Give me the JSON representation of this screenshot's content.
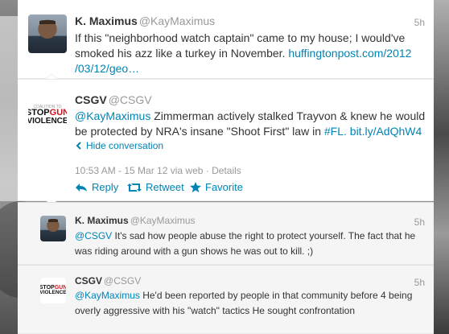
{
  "tweet1": {
    "name": "K. Maximus",
    "handle": "@KayMaximus",
    "time": "5h",
    "text_prefix": "If this \"neighborhood watch captain\" came to my house; I would've smoked his azz like a turkey in November.",
    "link_line1": "huffingtonpost.com/2012",
    "link_line2": "/03/12/geo…"
  },
  "tweet2": {
    "name": "CSGV",
    "handle": "@CSGV",
    "mention": "@KayMaximus",
    "text_mid": "Zimmerman actively stalked Trayvon & knew he would be protected by NRA's insane \"Shoot First\" law in",
    "hashtag": "#FL.",
    "link": "bit.ly/AdQhW4",
    "hide_label": "Hide conversation",
    "timestamp": "10:53 AM - 15 Mar 12",
    "via": "via web",
    "details": "Details",
    "actions": {
      "reply": "Reply",
      "retweet": "Retweet",
      "favorite": "Favorite"
    }
  },
  "reply1": {
    "name": "K. Maximus",
    "handle": "@KayMaximus",
    "time": "5h",
    "mention": "@CSGV",
    "text": "It's sad how people abuse the right to protect yourself. The fact that he was riding around with a gun shows he was out to kill. ;)"
  },
  "reply2": {
    "name": "CSGV",
    "handle": "@CSGV",
    "time": "5h",
    "mention": "@KayMaximus",
    "text": "He'd been reported by people in that community before 4 being overly aggressive with his \"watch\" tactics He sought confrontation"
  },
  "logo": {
    "line1a": "STOP",
    "line1b": "GUN",
    "line2": "VIOLENCE"
  },
  "colors": {
    "link": "#0084b4",
    "muted": "#999999",
    "logo_red": "#d0101c"
  }
}
